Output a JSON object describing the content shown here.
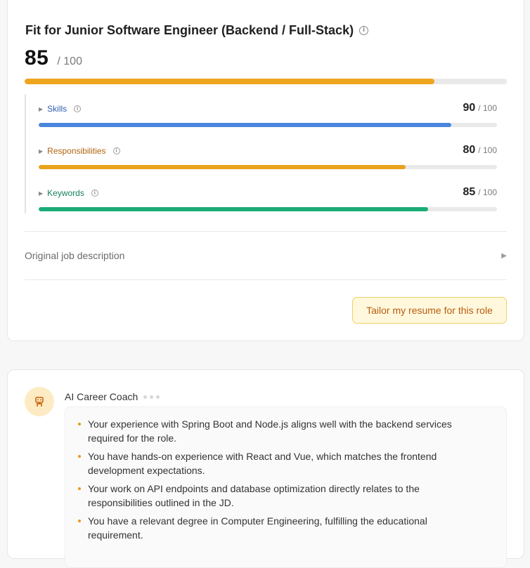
{
  "fit": {
    "title": "Fit for Junior Software Engineer (Backend / Full-Stack)",
    "score": "85",
    "score_of": "/ 100",
    "score_value": 85,
    "bar_color": "#f0a51e",
    "sections": [
      {
        "label": "Skills",
        "score": "90",
        "of": "/ 100",
        "value": 90,
        "label_color": "#2f5fae",
        "bar_color": "#4a86dd"
      },
      {
        "label": "Responsibilities",
        "score": "80",
        "of": "/ 100",
        "value": 80,
        "label_color": "#b0630f",
        "bar_color": "#e9a21c"
      },
      {
        "label": "Keywords",
        "score": "85",
        "of": "/ 100",
        "value": 85,
        "label_color": "#16805a",
        "bar_color": "#1cac78"
      }
    ],
    "jd_label": "Original job description",
    "tailor_button": "Tailor my resume for this role"
  },
  "coach": {
    "name": "AI Career Coach",
    "avatar_icon": "robot-icon",
    "bullets": [
      "Your experience with Spring Boot and Node.js aligns well with the backend services required for the role.",
      "You have hands-on experience with React and Vue, which matches the frontend development expectations.",
      "Your work on API endpoints and database optimization directly relates to the responsibilities outlined in the JD.",
      "You have a relevant degree in Computer Engineering, fulfilling the educational requirement."
    ]
  }
}
